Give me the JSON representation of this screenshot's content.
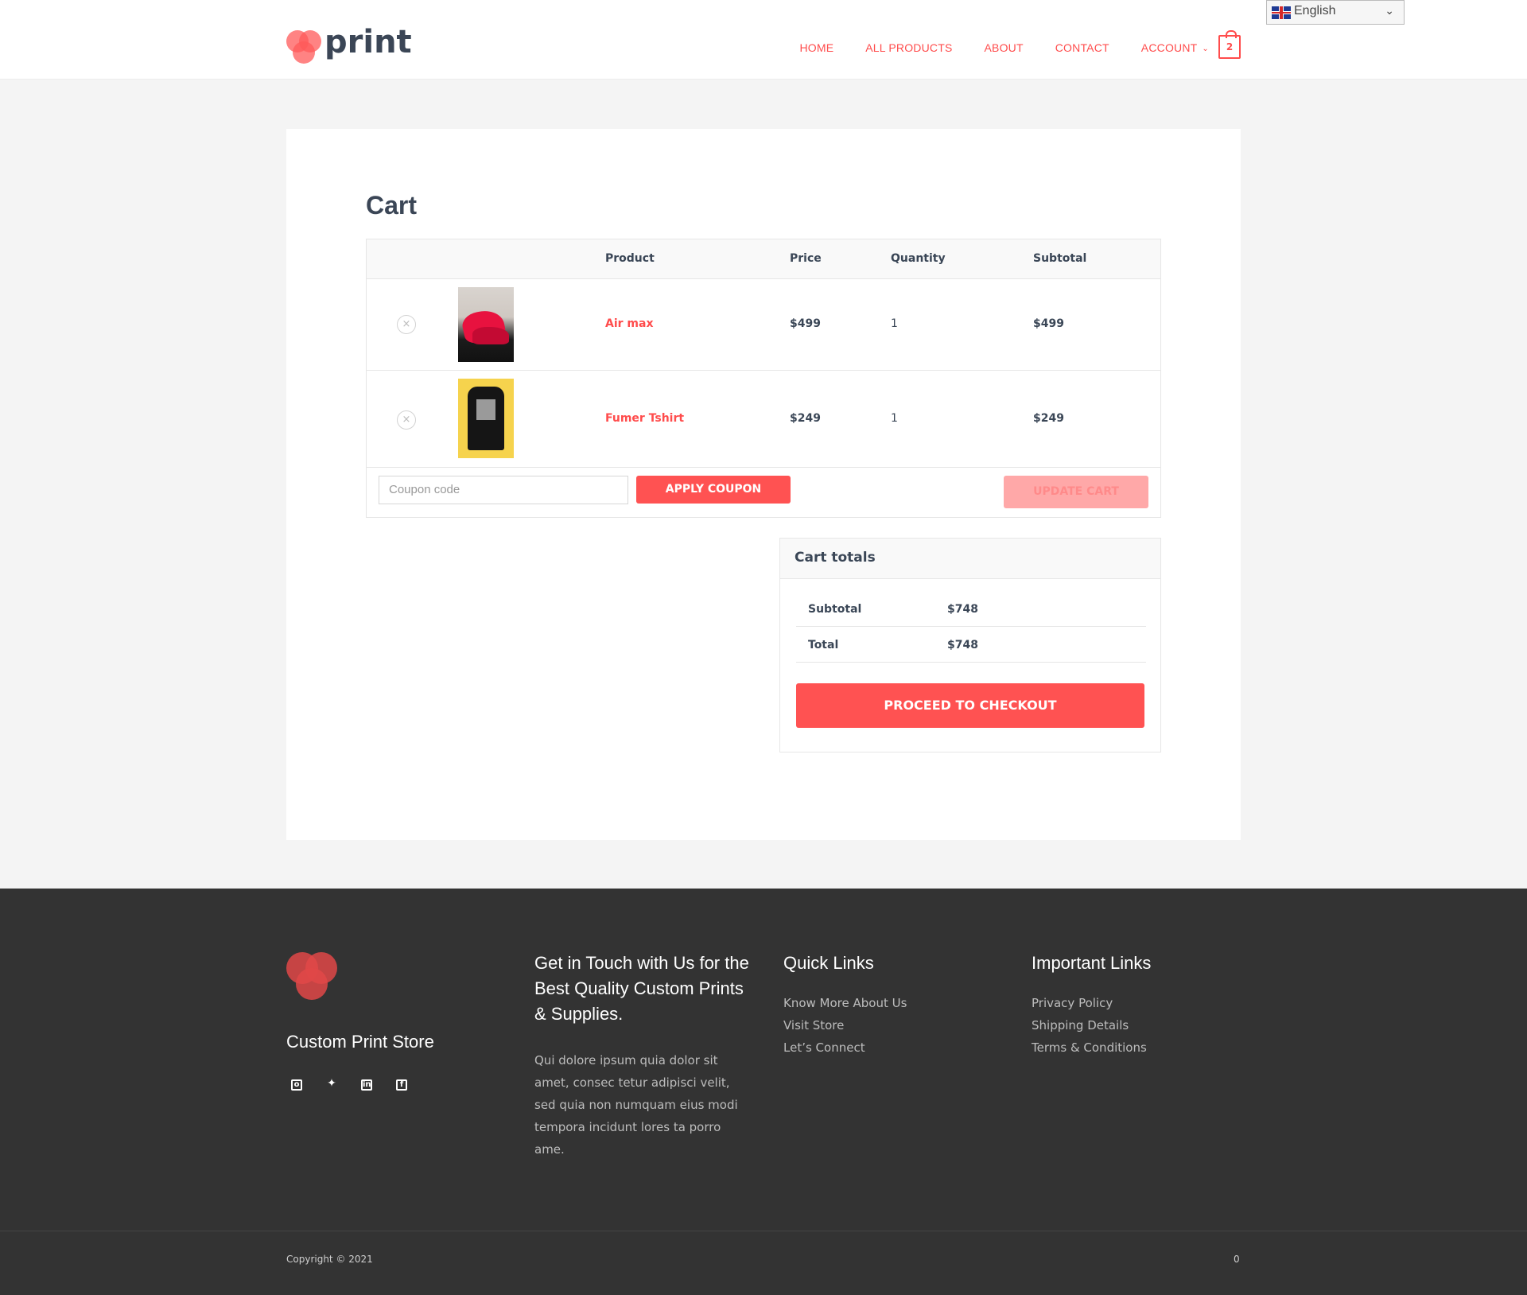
{
  "header": {
    "logo_text": "print",
    "nav": [
      "HOME",
      "ALL PRODUCTS",
      "ABOUT",
      "CONTACT",
      "ACCOUNT"
    ],
    "cart_count": "2",
    "language": "English"
  },
  "page": {
    "title": "Cart",
    "columns": [
      "Product",
      "Price",
      "Quantity",
      "Subtotal"
    ],
    "items": [
      {
        "name": "Air max",
        "price": "$499",
        "qty": "1",
        "subtotal": "$499"
      },
      {
        "name": "Fumer Tshirt",
        "price": "$249",
        "qty": "1",
        "subtotal": "$249"
      }
    ],
    "coupon_placeholder": "Coupon code",
    "apply_label": "APPLY COUPON",
    "update_label": "UPDATE CART"
  },
  "totals": {
    "title": "Cart totals",
    "subtotal_label": "Subtotal",
    "subtotal_value": "$748",
    "total_label": "Total",
    "total_value": "$748",
    "checkout_label": "PROCEED TO CHECKOUT"
  },
  "footer": {
    "store_name": "Custom Print Store",
    "contact_heading": "Get in Touch with Us for the Best Quality Custom Prints & Supplies.",
    "contact_text": "Qui dolore ipsum quia dolor sit amet, consec tetur adipisci velit, sed quia non numquam eius modi tempora incidunt lores ta porro ame.",
    "quick_heading": "Quick Links",
    "quick_links": [
      "Know More About Us",
      "Visit Store",
      "Let’s Connect"
    ],
    "important_heading": "Important Links",
    "important_links": [
      "Privacy Policy",
      "Shipping Details",
      "Terms & Conditions"
    ],
    "copyright": "Copyright © 2021",
    "right_text": "0"
  },
  "colors": {
    "accent": "#ff5252",
    "text": "#3a4656",
    "footer_bg": "#333333"
  },
  "icons": [
    "remove-icon",
    "cart-bag-icon",
    "flag-uk-icon",
    "instagram-icon",
    "twitter-icon",
    "linkedin-icon",
    "facebook-icon"
  ]
}
